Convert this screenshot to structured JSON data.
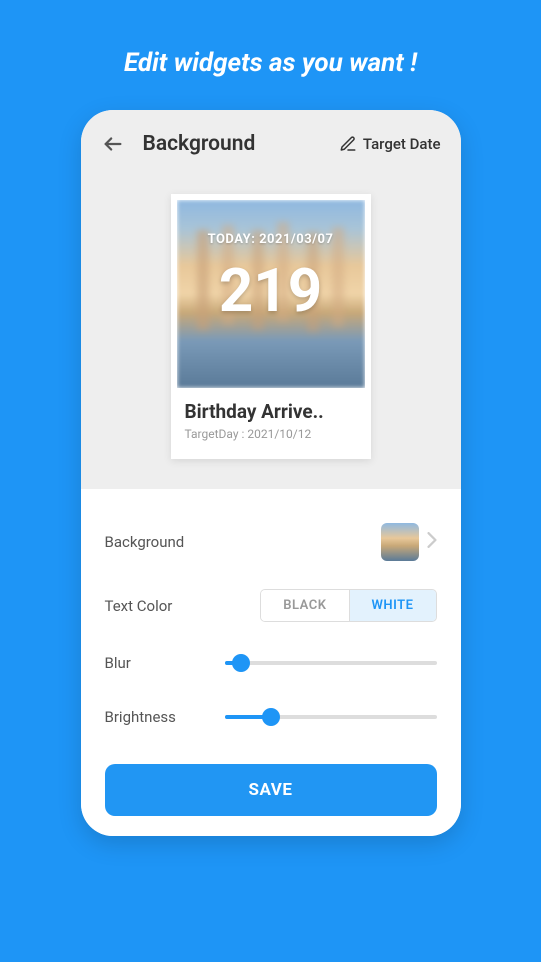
{
  "promo": {
    "title": "Edit widgets as you want !"
  },
  "header": {
    "title": "Background",
    "target_date_label": "Target Date"
  },
  "preview": {
    "today_label": "TODAY: 2021/03/07",
    "count": "219",
    "widget_title": "Birthday Arrive..",
    "widget_subtitle": "TargetDay : 2021/10/12"
  },
  "controls": {
    "background_label": "Background",
    "text_color_label": "Text Color",
    "text_color_options": {
      "black": "BLACK",
      "white": "WHITE"
    },
    "text_color_selected": "white",
    "blur_label": "Blur",
    "blur_value": 8,
    "brightness_label": "Brightness",
    "brightness_value": 22,
    "save_label": "SAVE"
  }
}
